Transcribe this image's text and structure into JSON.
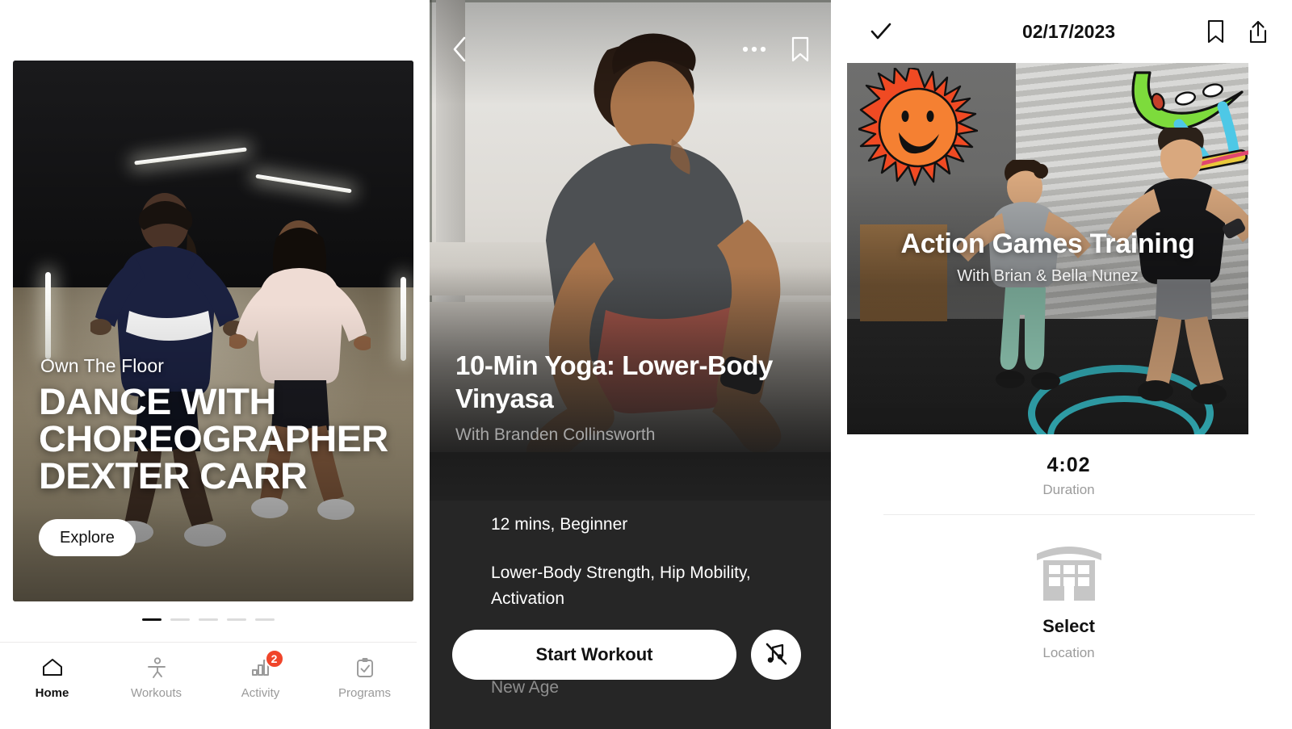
{
  "home": {
    "hero": {
      "eyebrow": "Own The Floor",
      "headline_line1": "DANCE WITH",
      "headline_line2": "CHOREOGRAPHER",
      "headline_line3": "DEXTER CARR",
      "cta_label": "Explore"
    },
    "carousel": {
      "total": 5,
      "active_index": 0
    },
    "tabs": [
      {
        "label": "Home",
        "icon": "home-icon",
        "active": true,
        "badge": null
      },
      {
        "label": "Workouts",
        "icon": "athlete-figure-icon",
        "active": false,
        "badge": null
      },
      {
        "label": "Activity",
        "icon": "bar-chart-icon",
        "active": false,
        "badge": "2"
      },
      {
        "label": "Programs",
        "icon": "clipboard-check-icon",
        "active": false,
        "badge": null
      }
    ]
  },
  "detail": {
    "topbar": {
      "back_icon": "chevron-left-icon",
      "more_icon": "ellipsis-icon",
      "bookmark_icon": "bookmark-icon"
    },
    "title": "10-Min Yoga: Lower-Body Vinyasa",
    "subtitle": "With Branden Collinsworth",
    "meta": "12 mins, Beginner",
    "focus": "Lower-Body Strength, Hip Mobility, Activation",
    "genre": "New Age",
    "start_label": "Start Workout",
    "music_icon": "music-off-icon"
  },
  "activity": {
    "topbar": {
      "confirm_icon": "check-icon",
      "date": "02/17/2023",
      "bookmark_icon": "bookmark-icon",
      "share_icon": "share-upload-icon"
    },
    "hero": {
      "title": "Action Games Training",
      "subtitle": "With Brian & Bella Nunez",
      "sticker_sun": "smiley-sun-sticker",
      "sticker_skate": "skateboard-swoosh-doodle"
    },
    "duration_value": "4:02",
    "duration_label": "Duration",
    "location": {
      "icon": "building-gym-icon",
      "value": "Select",
      "label": "Location"
    }
  },
  "colors": {
    "accent_red": "#f0452a",
    "ink": "#111111",
    "muted": "#9b9b9b",
    "panel_dark": "#262626",
    "teal": "#36b9c4",
    "sun_orange": "#f26b28"
  }
}
